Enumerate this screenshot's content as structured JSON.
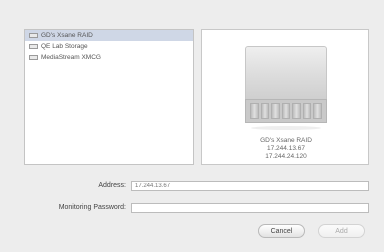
{
  "device_list": {
    "items": [
      {
        "label": "GD's Xsane RAID",
        "selected": true
      },
      {
        "label": "QE Lab Storage",
        "selected": false
      },
      {
        "label": "MediaStream XMCG",
        "selected": false
      }
    ]
  },
  "preview": {
    "name": "GD's Xsane RAID",
    "ip_1": "17.244.13.67",
    "ip_2": "17.244.24.120"
  },
  "form": {
    "address_label": "Address:",
    "address_value": "17.244.13.67",
    "password_label": "Monitoring Password:",
    "password_value": ""
  },
  "buttons": {
    "cancel": "Cancel",
    "add": "Add"
  }
}
